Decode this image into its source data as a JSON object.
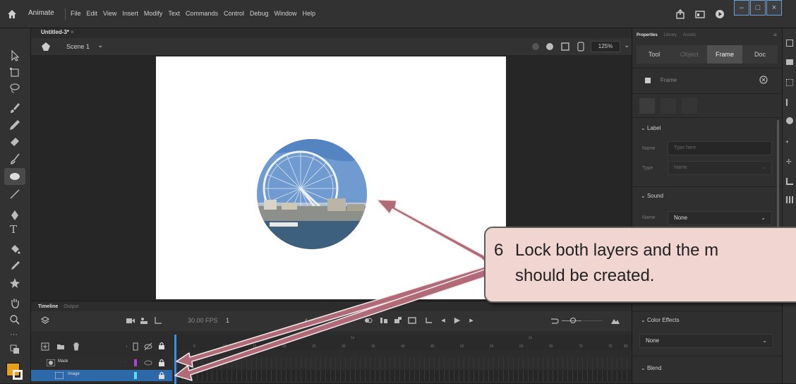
{
  "menubar": {
    "app_name": "Animate",
    "menus": [
      "File",
      "Edit",
      "View",
      "Insert",
      "Modify",
      "Text",
      "Commands",
      "Control",
      "Debug",
      "Window",
      "Help"
    ]
  },
  "document": {
    "tab": "Untitled-3*",
    "tab_close": "×",
    "scene": "Scene 1",
    "zoom": "125%"
  },
  "timeline": {
    "tabs": [
      "Timeline",
      "Output"
    ],
    "fps": "30.00 FPS",
    "current_frame": "1",
    "ruler_ticks": [
      "1s",
      "2s",
      "5",
      "10",
      "15",
      "20",
      "25",
      "30",
      "35",
      "40",
      "45",
      "50",
      "55",
      "60",
      "65",
      "70",
      "75",
      "80"
    ],
    "layers": [
      {
        "name": "Mask",
        "locked": true
      },
      {
        "name": "Image",
        "locked": true
      }
    ]
  },
  "properties": {
    "top_tabs": [
      "Properties",
      "Library",
      "Assets"
    ],
    "segments": [
      "Tool",
      "Object",
      "Frame",
      "Doc"
    ],
    "active_segment": "Frame",
    "frame_title": "Frame",
    "label_section": "Label",
    "name_label": "Name",
    "name_placeholder": "Type here",
    "type_label": "Type",
    "type_value": "Name",
    "sound_section": "Sound",
    "sound_name_label": "Name",
    "sound_value": "None",
    "color_effects_section": "Color Effects",
    "color_effects_value": "None",
    "blend_section": "Blend"
  },
  "callout": {
    "number": "6",
    "line1": "Lock both layers and the m",
    "line2": "should be created."
  },
  "colors": {
    "accent": "#3a8ee6",
    "callout_fill": "#f0d5d1",
    "arrow": "#b06a78",
    "fill_swatch": "#e5a11c"
  }
}
